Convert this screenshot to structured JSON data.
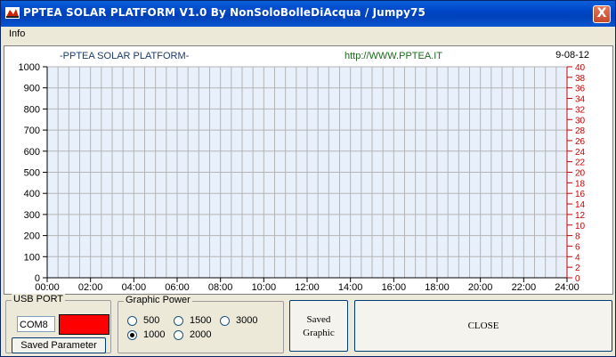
{
  "window": {
    "title": "PPTEA SOLAR PLATFORM V1.0 By NonSoloBolleDiAcqua / Jumpy75",
    "close_glyph": "X",
    "app_icon": "app-logo-icon"
  },
  "menu": {
    "items": [
      "Info"
    ]
  },
  "chart_header": {
    "title": "-PPTEA SOLAR PLATFORM-",
    "url": "http://WWW.PPTEA.IT",
    "date": "9-08-12"
  },
  "chart_data": {
    "type": "line",
    "title": "-PPTEA SOLAR PLATFORM-",
    "x_ticks": [
      "00:00",
      "02:00",
      "04:00",
      "06:00",
      "08:00",
      "10:00",
      "12:00",
      "14:00",
      "16:00",
      "18:00",
      "20:00",
      "22:00",
      "24:00"
    ],
    "left_axis": {
      "range": [
        0,
        1000
      ],
      "ticks": [
        "1000",
        "900",
        "800",
        "700",
        "600",
        "500",
        "400",
        "300",
        "200",
        "100",
        "0"
      ]
    },
    "right_axis": {
      "range": [
        0,
        40
      ],
      "ticks": [
        "40",
        "38",
        "36",
        "34",
        "32",
        "30",
        "28",
        "26",
        "24",
        "22",
        "20",
        "18",
        "16",
        "14",
        "12",
        "10",
        "8",
        "6",
        "4",
        "2",
        "0"
      ]
    },
    "grid": true,
    "series": [],
    "colors": {
      "plot_bg": "#e8f1fb",
      "grid": "#b4b4b4",
      "right_axis": "#cc0000",
      "url": "#1a6b1a"
    }
  },
  "usb_port": {
    "label": "USB PORT",
    "port_value": "COM8",
    "status_color": "#ff0000",
    "saved_parameter_label": "Saved Parameter"
  },
  "graphic_power": {
    "label": "Graphic Power",
    "options": [
      {
        "label": "500",
        "selected": false
      },
      {
        "label": "1500",
        "selected": false
      },
      {
        "label": "3000",
        "selected": false
      },
      {
        "label": "1000",
        "selected": true
      },
      {
        "label": "2000",
        "selected": false
      }
    ]
  },
  "saved_graphic": {
    "line1": "Saved",
    "line2": "Graphic"
  },
  "close_button": {
    "label": "CLOSE"
  }
}
